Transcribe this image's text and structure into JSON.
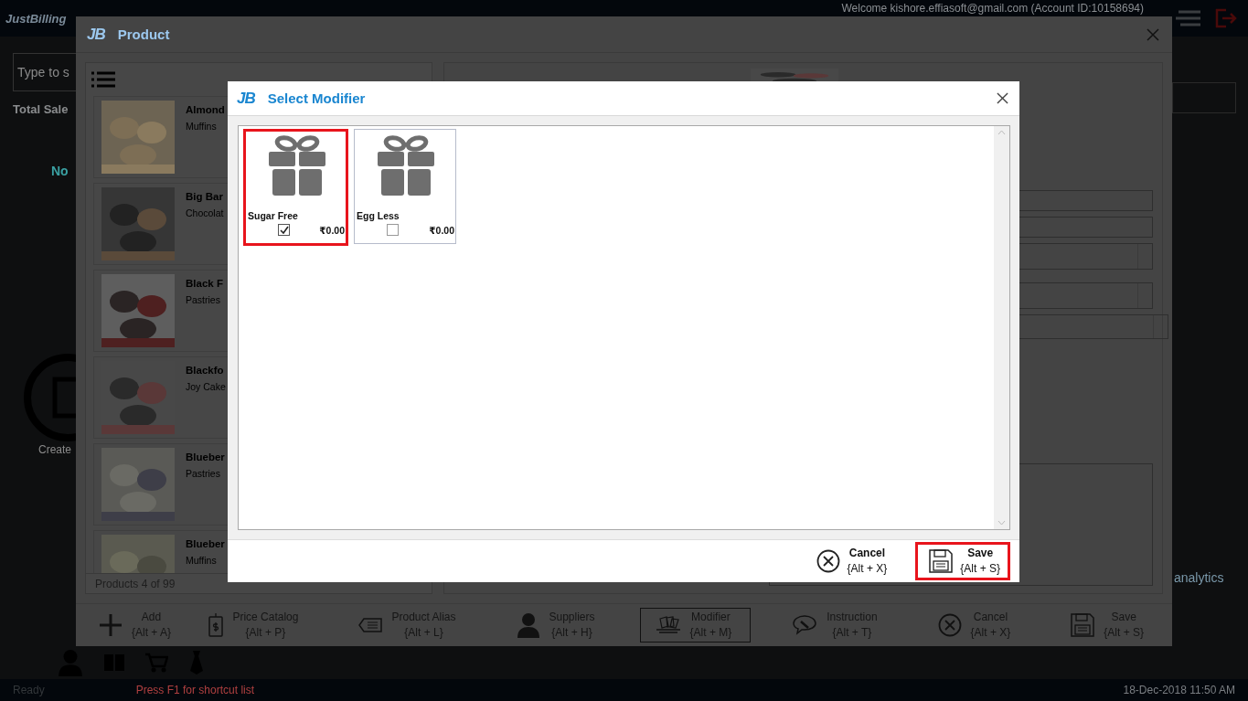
{
  "app": {
    "logo": "JustBilling",
    "welcome": "Welcome kishore.effiasoft@gmail.com (Account ID:10158694)",
    "search": {
      "placeholder": "Type to s"
    },
    "total_sales": "Total Sale",
    "label_no": "No",
    "create": "Create",
    "analytics": "analytics",
    "status_bar": {
      "status": "Ready",
      "hint": "Press F1 for shortcut list",
      "datetime": "18-Dec-2018 11:50 AM"
    }
  },
  "product_dialog": {
    "logo": "JB",
    "title": "Product",
    "products": [
      {
        "name": "Almond",
        "category": "Muffins"
      },
      {
        "name": "Big Bar",
        "category": "Chocolat"
      },
      {
        "name": "Black F",
        "category": "Pastries"
      },
      {
        "name": "Blackfo",
        "category": "Joy Cake"
      },
      {
        "name": "Blueber",
        "category": "Pastries"
      },
      {
        "name": "Blueber",
        "category": "Muffins"
      }
    ],
    "count": "Products 4 of 99",
    "toolbar": [
      {
        "kind": "add",
        "label": "Add",
        "shortcut": "{Alt + A}",
        "selected": false
      },
      {
        "kind": "price",
        "label": "Price Catalog",
        "shortcut": "{Alt + P}",
        "selected": false
      },
      {
        "kind": "alias",
        "label": "Product Alias",
        "shortcut": "{Alt + L}",
        "selected": false
      },
      {
        "kind": "suppliers",
        "label": "Suppliers",
        "shortcut": "{Alt + H}",
        "selected": false
      },
      {
        "kind": "modifier",
        "label": "Modifier",
        "shortcut": "{Alt + M}",
        "selected": true
      },
      {
        "kind": "instruction",
        "label": "Instruction",
        "shortcut": "{Alt + T}",
        "selected": false
      },
      {
        "kind": "cancel",
        "label": "Cancel",
        "shortcut": "{Alt + X}",
        "selected": false
      },
      {
        "kind": "save",
        "label": "Save",
        "shortcut": "{Alt + S}",
        "selected": false
      }
    ]
  },
  "modifier_dialog": {
    "logo": "JB",
    "title": "Select Modifier",
    "modifiers": [
      {
        "name": "Sugar Free",
        "price": "₹0.00",
        "checked": true,
        "highlighted": true
      },
      {
        "name": "Egg Less",
        "price": "₹0.00",
        "checked": false,
        "highlighted": false
      }
    ],
    "buttons": [
      {
        "kind": "cancel",
        "label": "Cancel",
        "shortcut": "{Alt + X}",
        "highlighted": false
      },
      {
        "kind": "save",
        "label": "Save",
        "shortcut": "{Alt + S}",
        "highlighted": true
      }
    ]
  }
}
